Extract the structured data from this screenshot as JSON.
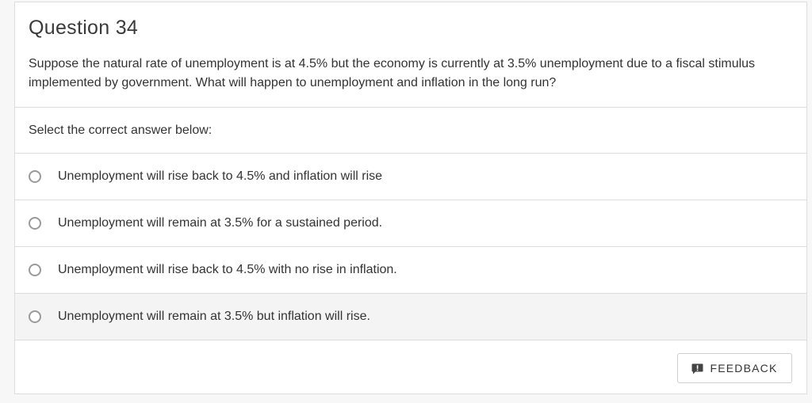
{
  "question": {
    "title": "Question 34",
    "text": "Suppose the natural rate of unemployment is at 4.5% but the economy is currently at 3.5% unemployment due to a fiscal stimulus implemented by government. What will happen to unemployment and inflation in the long run?"
  },
  "instruction": "Select the correct answer below:",
  "options": [
    {
      "label": "Unemployment will rise back to 4.5% and inflation will rise"
    },
    {
      "label": "Unemployment will remain at 3.5% for a sustained period."
    },
    {
      "label": "Unemployment will rise back to 4.5% with no rise in inflation."
    },
    {
      "label": "Unemployment will remain at 3.5% but inflation will rise."
    }
  ],
  "feedback": {
    "label": "FEEDBACK",
    "icon": "feedback-icon"
  },
  "colors": {
    "border": "#dcdcdc",
    "text": "#333333",
    "hover_row": "#f4f4f4",
    "radio_border": "#9a9a9a"
  }
}
